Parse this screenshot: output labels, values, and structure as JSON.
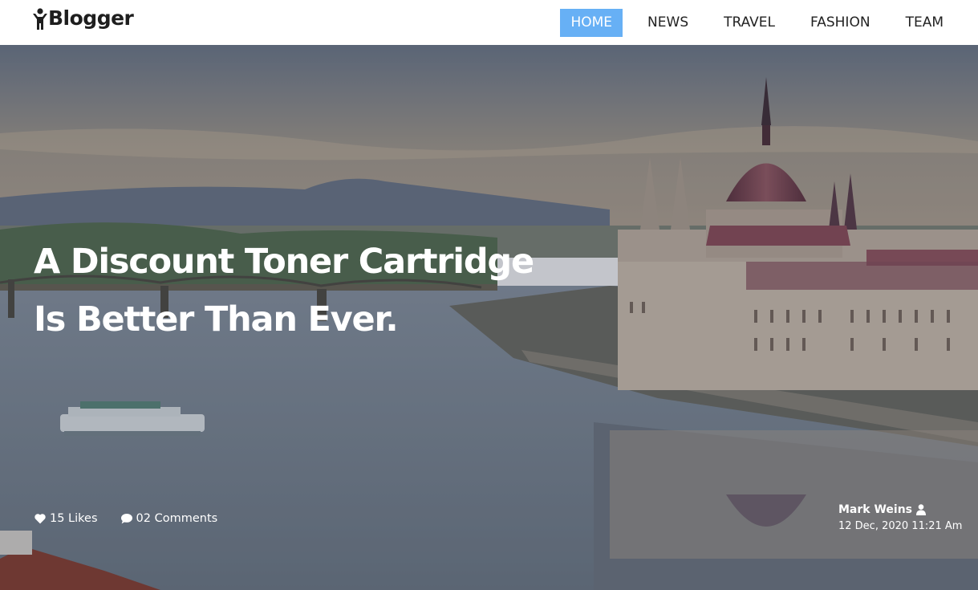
{
  "brand": {
    "name": "Blogger",
    "icon": "person-arms-up-icon"
  },
  "nav": {
    "items": [
      {
        "label": "HOME",
        "active": true
      },
      {
        "label": "NEWS",
        "active": false
      },
      {
        "label": "TRAVEL",
        "active": false
      },
      {
        "label": "FASHION",
        "active": false
      },
      {
        "label": "TEAM",
        "active": false
      }
    ],
    "active_color": "#67b0f5"
  },
  "hero": {
    "headline_line1": "A Discount Toner Cartridge",
    "headline_line2": "Is Better Than Ever.",
    "likes": "15 Likes",
    "comments": "02 Comments",
    "author": "Mark Weins",
    "date": "12 Dec, 2020 11:21 Am",
    "icons": {
      "likes": "heart-icon",
      "comments": "speech-bubble-icon",
      "author": "user-icon"
    }
  }
}
